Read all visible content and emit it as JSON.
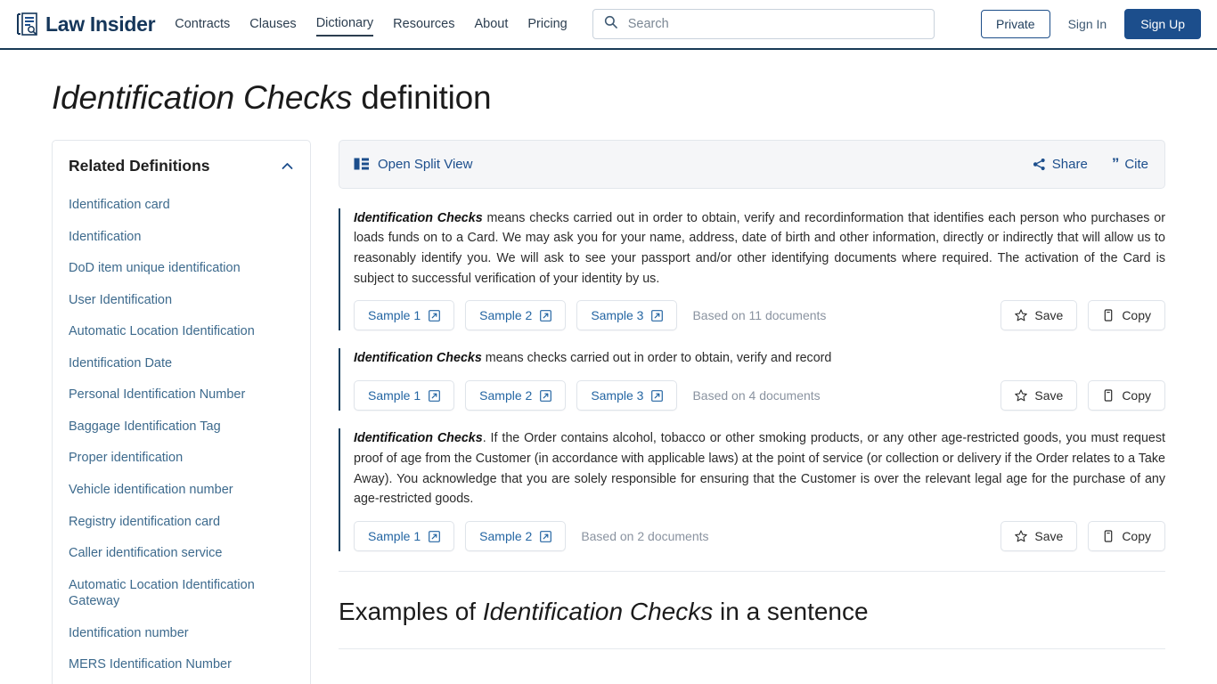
{
  "header": {
    "brand": "Law Insider",
    "brand_icon": "document-search-logo-icon",
    "nav": [
      {
        "label": "Contracts",
        "active": false
      },
      {
        "label": "Clauses",
        "active": false
      },
      {
        "label": "Dictionary",
        "active": true
      },
      {
        "label": "Resources",
        "active": false
      },
      {
        "label": "About",
        "active": false
      },
      {
        "label": "Pricing",
        "active": false
      }
    ],
    "search": {
      "placeholder": "Search",
      "value": "",
      "icon": "search-icon"
    },
    "private_label": "Private",
    "signin_label": "Sign In",
    "signup_label": "Sign Up",
    "accent_color": "#1c4e8c",
    "border_color": "#173a56"
  },
  "page": {
    "title_term": "Identification Checks",
    "title_suffix": " definition"
  },
  "sidebar": {
    "title": "Related Definitions",
    "collapse_icon": "chevron-up-icon",
    "items": [
      {
        "label": "Identification card"
      },
      {
        "label": "Identification"
      },
      {
        "label": "DoD item unique identification"
      },
      {
        "label": "User Identification"
      },
      {
        "label": "Automatic Location Identification"
      },
      {
        "label": "Identification Date"
      },
      {
        "label": "Personal Identification Number"
      },
      {
        "label": "Baggage Identification Tag"
      },
      {
        "label": "Proper identification"
      },
      {
        "label": "Vehicle identification number"
      },
      {
        "label": "Registry identification card"
      },
      {
        "label": "Caller identification service"
      },
      {
        "label": "Automatic Location Identification Gateway"
      },
      {
        "label": "Identification number"
      },
      {
        "label": "MERS Identification Number"
      }
    ]
  },
  "toolbar": {
    "split_view_label": "Open Split View",
    "split_view_icon": "split-view-icon",
    "share_label": "Share",
    "share_icon": "share-icon",
    "cite_label": "Cite",
    "cite_icon": "quote-icon"
  },
  "definitions": [
    {
      "term": "Identification Checks",
      "body": " means checks carried out in order to obtain, verify and recordinformation that identifies each person who purchases or loads funds on to a Card. We may ask you for your name, address, date of birth and other information, directly or indirectly that will allow us to reasonably identify you. We will ask to see your passport and/or other identifying documents where required. The activation of the Card is subject to successful verification of your identity by us.",
      "samples": [
        "Sample 1",
        "Sample 2",
        "Sample 3"
      ],
      "based_on": "Based on 11 documents",
      "save_label": "Save",
      "copy_label": "Copy"
    },
    {
      "term": "Identification Checks",
      "body": " means checks carried out in order to obtain, verify and record",
      "samples": [
        "Sample 1",
        "Sample 2",
        "Sample 3"
      ],
      "based_on": "Based on 4 documents",
      "save_label": "Save",
      "copy_label": "Copy"
    },
    {
      "term": "Identification Checks",
      "body": ". If the Order contains alcohol, tobacco or other smoking products, or any other age-restricted goods, you must request proof of age from the Customer (in accordance with applicable laws) at the point of service (or collection or delivery if the Order relates to a Take Away). You acknowledge that you are solely responsible for ensuring that the Customer is over the relevant legal age for the purchase of any age-restricted goods.",
      "samples": [
        "Sample 1",
        "Sample 2"
      ],
      "based_on": "Based on 2 documents",
      "save_label": "Save",
      "copy_label": "Copy"
    }
  ],
  "examples": {
    "prefix": "Examples of ",
    "term": "Identification Checks",
    "suffix": " in a sentence"
  }
}
